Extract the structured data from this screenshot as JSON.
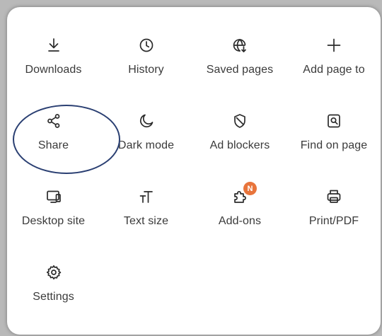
{
  "menu": {
    "items": [
      {
        "label": "Downloads",
        "icon": "download-icon"
      },
      {
        "label": "History",
        "icon": "clock-icon"
      },
      {
        "label": "Saved pages",
        "icon": "globe-download-icon"
      },
      {
        "label": "Add page to",
        "icon": "plus-icon"
      },
      {
        "label": "Share",
        "icon": "share-icon"
      },
      {
        "label": "Dark mode",
        "icon": "moon-icon"
      },
      {
        "label": "Ad blockers",
        "icon": "shield-icon"
      },
      {
        "label": "Find on page",
        "icon": "search-page-icon"
      },
      {
        "label": "Desktop site",
        "icon": "desktop-icon"
      },
      {
        "label": "Text size",
        "icon": "text-size-icon"
      },
      {
        "label": "Add-ons",
        "icon": "puzzle-icon",
        "badge": "N"
      },
      {
        "label": "Print/PDF",
        "icon": "printer-icon"
      },
      {
        "label": "Settings",
        "icon": "gear-icon"
      }
    ]
  },
  "colors": {
    "badge": "#e8743b",
    "highlight": "#2a3f72",
    "panel": "#ffffff",
    "text": "#3a3a3a"
  }
}
